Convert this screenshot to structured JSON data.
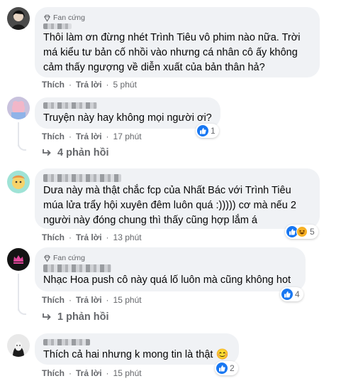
{
  "comments": [
    {
      "badge": "Fan cứng",
      "text": "Thôi làm ơn đừng nhét Trình Tiêu vô phim nào nữa. Trời má kiểu tư bản cố nhồi vào nhưng cá nhân cô ấy không cảm thấy ngượng về diễn xuất của bản thân hả?",
      "like": "Thích",
      "reply": "Trả lời",
      "time": "5 phút"
    },
    {
      "text": "Truyện này hay không mọi người ơi?",
      "like": "Thích",
      "reply": "Trả lời",
      "time": "17 phút",
      "reaction_count": "1",
      "replies_label": "4 phản hồi"
    },
    {
      "text": "Dưa này mà thật chắc fcp của Nhất Bác với Trình Tiêu múa lửa trẩy hội xuyên đêm luôn quá :))))) cơ mà nếu 2 người này đóng chung thì thấy cũng hợp lắm á",
      "like": "Thích",
      "reply": "Trả lời",
      "time": "13 phút",
      "reaction_count": "5"
    },
    {
      "badge": "Fan cứng",
      "text": "Nhạc Hoa push cô này quá lố luôn mà cũng không hot",
      "like": "Thích",
      "reply": "Trả lời",
      "time": "15 phút",
      "reaction_count": "4",
      "replies_label": "1 phản hồi"
    },
    {
      "text": "Thích cả hai nhưng k mong tin là thật 😊",
      "like": "Thích",
      "reply": "Trả lời",
      "time": "15 phút",
      "reaction_count": "2"
    }
  ],
  "separator": "·",
  "colors": {
    "bubble": "#f0f2f5",
    "meta": "#65676b",
    "like_blue": "#1877f2",
    "haha_yellow": "#f7b125"
  },
  "icons": [
    "like-reaction-icon",
    "haha-reaction-icon",
    "reply-arrow-icon",
    "fan-badge-diamond-icon"
  ]
}
